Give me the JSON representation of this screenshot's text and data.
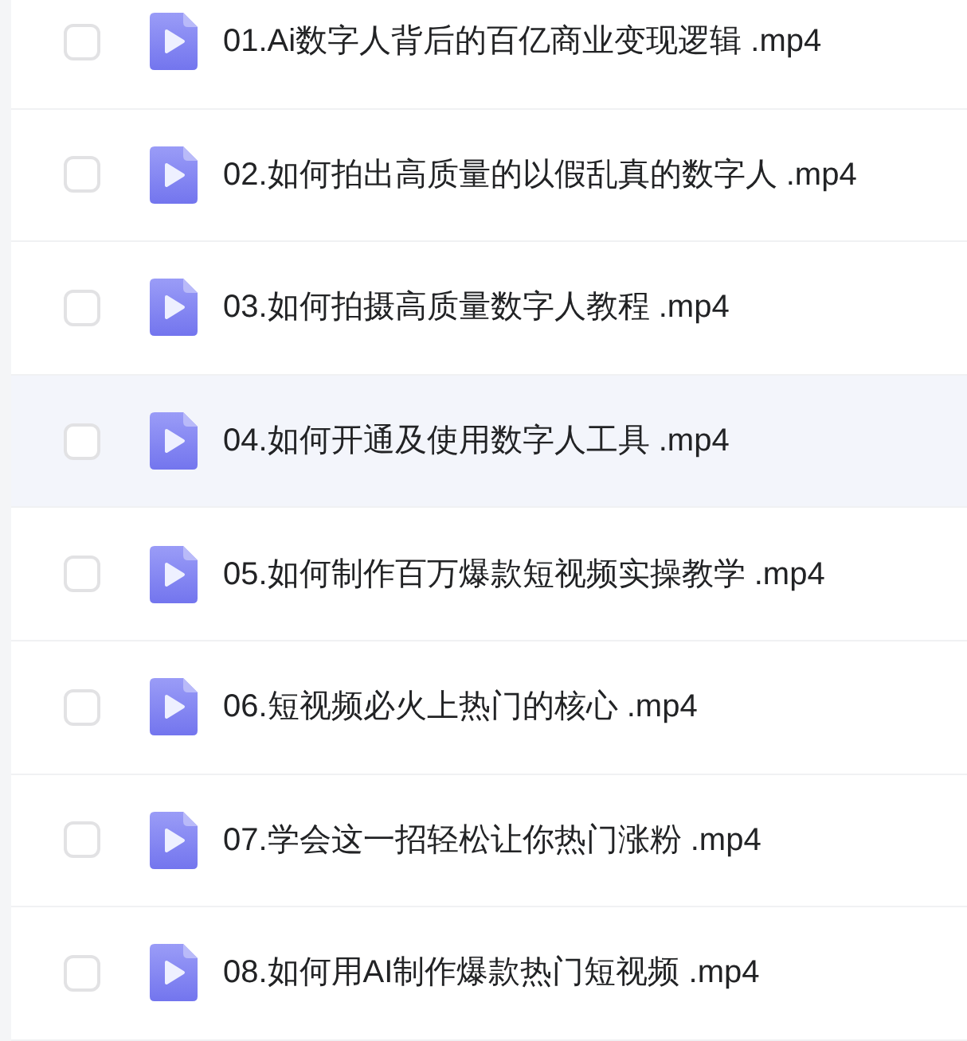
{
  "files": [
    {
      "name": "01.Ai数字人背后的百亿商业变现逻辑 .mp4",
      "checked": false,
      "highlighted": false
    },
    {
      "name": "02.如何拍出高质量的以假乱真的数字人 .mp4",
      "checked": false,
      "highlighted": false
    },
    {
      "name": "03.如何拍摄高质量数字人教程 .mp4",
      "checked": false,
      "highlighted": false
    },
    {
      "name": "04.如何开通及使用数字人工具 .mp4",
      "checked": false,
      "highlighted": true
    },
    {
      "name": "05.如何制作百万爆款短视频实操教学 .mp4",
      "checked": false,
      "highlighted": false
    },
    {
      "name": "06.短视频必火上热门的核心 .mp4",
      "checked": false,
      "highlighted": false
    },
    {
      "name": "07.学会这一招轻松让你热门涨粉 .mp4",
      "checked": false,
      "highlighted": false
    },
    {
      "name": "08.如何用AI制作爆款热门短视频 .mp4",
      "checked": false,
      "highlighted": false
    }
  ]
}
